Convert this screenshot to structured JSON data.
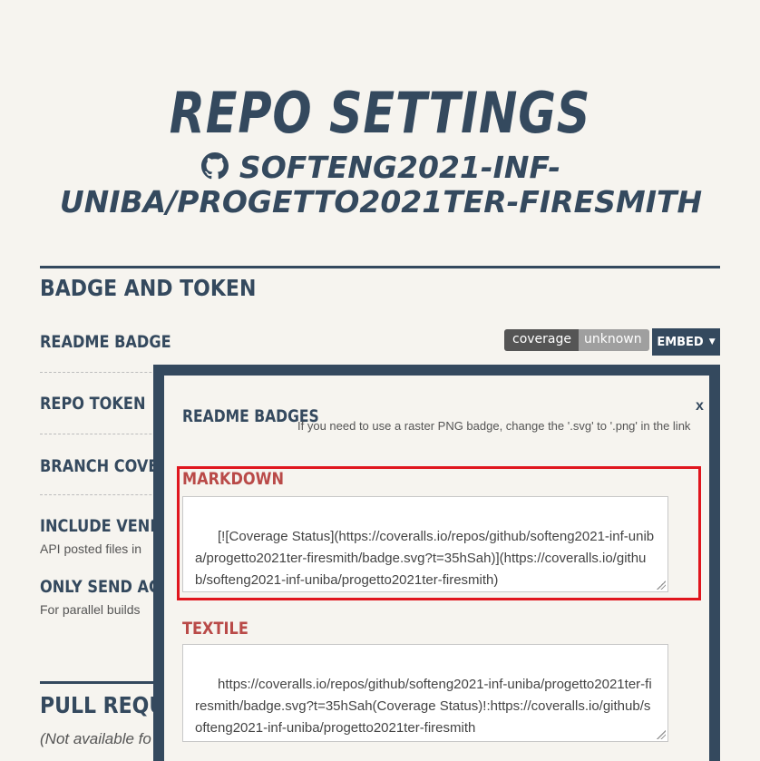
{
  "page": {
    "title": "REPO SETTINGS",
    "repo_name": "SOFTENG2021-INF-UNIBA/PROGETTO2021TER-FIRESMITH"
  },
  "badge_token": {
    "heading": "BADGE AND TOKEN",
    "readme_badge_label": "README BADGE",
    "badge_left": "coverage",
    "badge_right": "unknown",
    "embed_label": "EMBED",
    "repo_token_label": "REPO TOKEN",
    "branch_coverage_label": "BRANCH COVERA",
    "include_vendor_label": "INCLUDE VENDO",
    "include_vendor_desc": "API posted files in",
    "only_send_label": "ONLY SEND AGG",
    "only_send_desc": "For parallel builds"
  },
  "pull_requests": {
    "heading": "PULL REQUES",
    "note": "(Not available fo"
  },
  "modal": {
    "close_label": "x",
    "title": "README BADGES",
    "hint": "If you need to use a raster PNG badge, change the '.svg' to '.png' in the link",
    "markdown_label": "MARKDOWN",
    "markdown_code": "[![Coverage Status](https://coveralls.io/repos/github/softeng2021-inf-uniba/progetto2021ter-firesmith/badge.svg?t=35hSah)](https://coveralls.io/github/softeng2021-inf-uniba/progetto2021ter-firesmith)",
    "textile_label": "TEXTILE",
    "textile_code": "https://coveralls.io/repos/github/softeng2021-inf-uniba/progetto2021ter-firesmith/badge.svg?t=35hSah(Coverage Status)!:https://coveralls.io/github/softeng2021-inf-uniba/progetto2021ter-firesmith"
  },
  "colors": {
    "primary": "#34495e",
    "section_label": "#b94a48",
    "highlight": "#e0161e",
    "background": "#f6f4ef"
  },
  "icons": {
    "repo": "github-icon"
  }
}
